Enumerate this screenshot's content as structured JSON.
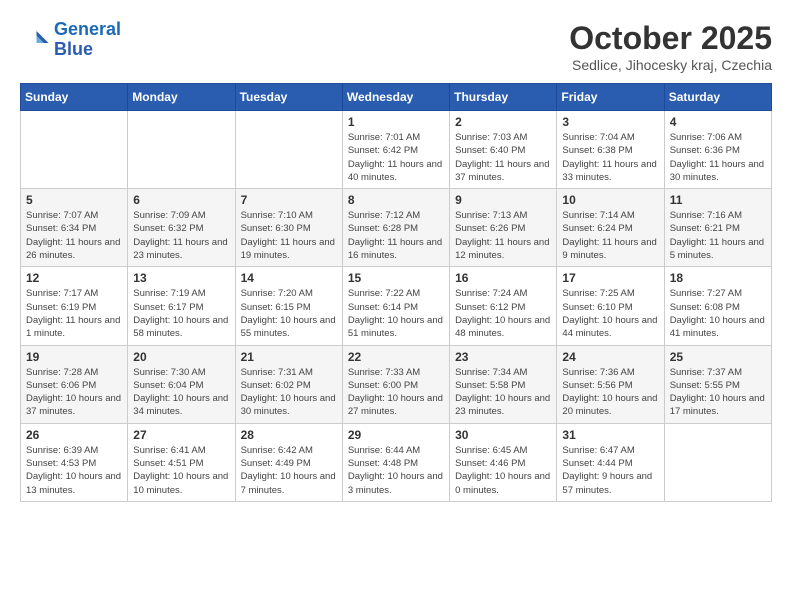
{
  "header": {
    "logo_line1": "General",
    "logo_line2": "Blue",
    "month": "October 2025",
    "location": "Sedlice, Jihocesky kraj, Czechia"
  },
  "weekdays": [
    "Sunday",
    "Monday",
    "Tuesday",
    "Wednesday",
    "Thursday",
    "Friday",
    "Saturday"
  ],
  "weeks": [
    [
      {
        "day": "",
        "info": ""
      },
      {
        "day": "",
        "info": ""
      },
      {
        "day": "",
        "info": ""
      },
      {
        "day": "1",
        "info": "Sunrise: 7:01 AM\nSunset: 6:42 PM\nDaylight: 11 hours and 40 minutes."
      },
      {
        "day": "2",
        "info": "Sunrise: 7:03 AM\nSunset: 6:40 PM\nDaylight: 11 hours and 37 minutes."
      },
      {
        "day": "3",
        "info": "Sunrise: 7:04 AM\nSunset: 6:38 PM\nDaylight: 11 hours and 33 minutes."
      },
      {
        "day": "4",
        "info": "Sunrise: 7:06 AM\nSunset: 6:36 PM\nDaylight: 11 hours and 30 minutes."
      }
    ],
    [
      {
        "day": "5",
        "info": "Sunrise: 7:07 AM\nSunset: 6:34 PM\nDaylight: 11 hours and 26 minutes."
      },
      {
        "day": "6",
        "info": "Sunrise: 7:09 AM\nSunset: 6:32 PM\nDaylight: 11 hours and 23 minutes."
      },
      {
        "day": "7",
        "info": "Sunrise: 7:10 AM\nSunset: 6:30 PM\nDaylight: 11 hours and 19 minutes."
      },
      {
        "day": "8",
        "info": "Sunrise: 7:12 AM\nSunset: 6:28 PM\nDaylight: 11 hours and 16 minutes."
      },
      {
        "day": "9",
        "info": "Sunrise: 7:13 AM\nSunset: 6:26 PM\nDaylight: 11 hours and 12 minutes."
      },
      {
        "day": "10",
        "info": "Sunrise: 7:14 AM\nSunset: 6:24 PM\nDaylight: 11 hours and 9 minutes."
      },
      {
        "day": "11",
        "info": "Sunrise: 7:16 AM\nSunset: 6:21 PM\nDaylight: 11 hours and 5 minutes."
      }
    ],
    [
      {
        "day": "12",
        "info": "Sunrise: 7:17 AM\nSunset: 6:19 PM\nDaylight: 11 hours and 1 minute."
      },
      {
        "day": "13",
        "info": "Sunrise: 7:19 AM\nSunset: 6:17 PM\nDaylight: 10 hours and 58 minutes."
      },
      {
        "day": "14",
        "info": "Sunrise: 7:20 AM\nSunset: 6:15 PM\nDaylight: 10 hours and 55 minutes."
      },
      {
        "day": "15",
        "info": "Sunrise: 7:22 AM\nSunset: 6:14 PM\nDaylight: 10 hours and 51 minutes."
      },
      {
        "day": "16",
        "info": "Sunrise: 7:24 AM\nSunset: 6:12 PM\nDaylight: 10 hours and 48 minutes."
      },
      {
        "day": "17",
        "info": "Sunrise: 7:25 AM\nSunset: 6:10 PM\nDaylight: 10 hours and 44 minutes."
      },
      {
        "day": "18",
        "info": "Sunrise: 7:27 AM\nSunset: 6:08 PM\nDaylight: 10 hours and 41 minutes."
      }
    ],
    [
      {
        "day": "19",
        "info": "Sunrise: 7:28 AM\nSunset: 6:06 PM\nDaylight: 10 hours and 37 minutes."
      },
      {
        "day": "20",
        "info": "Sunrise: 7:30 AM\nSunset: 6:04 PM\nDaylight: 10 hours and 34 minutes."
      },
      {
        "day": "21",
        "info": "Sunrise: 7:31 AM\nSunset: 6:02 PM\nDaylight: 10 hours and 30 minutes."
      },
      {
        "day": "22",
        "info": "Sunrise: 7:33 AM\nSunset: 6:00 PM\nDaylight: 10 hours and 27 minutes."
      },
      {
        "day": "23",
        "info": "Sunrise: 7:34 AM\nSunset: 5:58 PM\nDaylight: 10 hours and 23 minutes."
      },
      {
        "day": "24",
        "info": "Sunrise: 7:36 AM\nSunset: 5:56 PM\nDaylight: 10 hours and 20 minutes."
      },
      {
        "day": "25",
        "info": "Sunrise: 7:37 AM\nSunset: 5:55 PM\nDaylight: 10 hours and 17 minutes."
      }
    ],
    [
      {
        "day": "26",
        "info": "Sunrise: 6:39 AM\nSunset: 4:53 PM\nDaylight: 10 hours and 13 minutes."
      },
      {
        "day": "27",
        "info": "Sunrise: 6:41 AM\nSunset: 4:51 PM\nDaylight: 10 hours and 10 minutes."
      },
      {
        "day": "28",
        "info": "Sunrise: 6:42 AM\nSunset: 4:49 PM\nDaylight: 10 hours and 7 minutes."
      },
      {
        "day": "29",
        "info": "Sunrise: 6:44 AM\nSunset: 4:48 PM\nDaylight: 10 hours and 3 minutes."
      },
      {
        "day": "30",
        "info": "Sunrise: 6:45 AM\nSunset: 4:46 PM\nDaylight: 10 hours and 0 minutes."
      },
      {
        "day": "31",
        "info": "Sunrise: 6:47 AM\nSunset: 4:44 PM\nDaylight: 9 hours and 57 minutes."
      },
      {
        "day": "",
        "info": ""
      }
    ]
  ]
}
